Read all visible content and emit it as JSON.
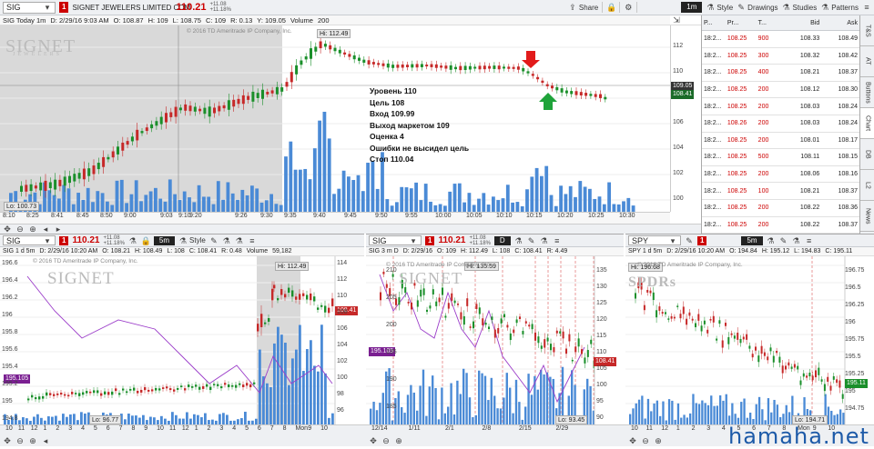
{
  "top": {
    "symbol": "SIG",
    "flag": "1",
    "company": "SIGNET JEWELERS LIMITED COM",
    "price": "110.21",
    "chg1": "+11.08",
    "chg2": "+11.18%",
    "share": "Share",
    "lock": "",
    "gear": ""
  },
  "main_toolbar": {
    "time": "1m",
    "style": "Style",
    "drawings": "Drawings",
    "studies": "Studies",
    "patterns": "Patterns"
  },
  "main_info": {
    "title": "SIG Today 1m",
    "date": "D: 2/29/16 9:03 AM",
    "o": "O: 108.87",
    "h": "H: 109",
    "l": "L: 108.75",
    "c": "C: 109",
    "r": "R: 0.13",
    "y": "Y: 109.05",
    "vol": "Volume",
    "volv": "200"
  },
  "badges": [
    {
      "t": "lomonov",
      "c": "#333"
    },
    {
      "t": "ATR 4.19",
      "c": "#333"
    },
    {
      "t": "Vol 2,090,444",
      "c": "#8bd17f"
    },
    {
      "t": "VolPlay 1.5",
      "c": "#8bd17f"
    },
    {
      "t": "3.8%",
      "c": "#f0a0a0"
    },
    {
      "t": "M 59%",
      "c": "#7a1f91"
    },
    {
      "t": "D 25%",
      "c": "#f6a01a"
    }
  ],
  "main": {
    "copyright": "© 2016 TD Ameritrade IP Company, Inc.",
    "hi": "Hi: 112.49",
    "lo": "Lo: 100.73",
    "tag_price": "109.05",
    "tag_price2": "108.41",
    "yticks": [
      "112",
      "110",
      "108",
      "106",
      "104",
      "102",
      "100"
    ],
    "xticks": [
      "8:10",
      "8:25",
      "8:41",
      "8:45",
      "8:50",
      "9:00",
      "9:03",
      "9:10",
      "9:20",
      "9:26",
      "9:30",
      "9:35",
      "9:40",
      "9:45",
      "9:50",
      "9:55",
      "10:00",
      "10:05",
      "10:10",
      "10:15",
      "10:20",
      "10:25",
      "10:30"
    ],
    "note": [
      "Уровень 110",
      "Цель 108",
      "Вход 109.99",
      "Выход маркетом 109",
      "Оценка 4",
      "Ошибки не высидел цель",
      " Стоп 110.04"
    ]
  },
  "ts": {
    "headers": [
      "P...",
      "Pr...",
      "T...",
      "Bid",
      "Ask"
    ],
    "rows": [
      [
        "18:2...",
        "108.25",
        "900",
        "108.33",
        "108.49"
      ],
      [
        "18:2...",
        "108.25",
        "300",
        "108.32",
        "108.42"
      ],
      [
        "18:2...",
        "108.25",
        "400",
        "108.21",
        "108.37"
      ],
      [
        "18:2...",
        "108.25",
        "200",
        "108.12",
        "108.30"
      ],
      [
        "18:2...",
        "108.25",
        "200",
        "108.03",
        "108.24"
      ],
      [
        "18:2...",
        "108.26",
        "200",
        "108.03",
        "108.24"
      ],
      [
        "18:2...",
        "108.25",
        "200",
        "108.01",
        "108.17"
      ],
      [
        "18:2...",
        "108.25",
        "500",
        "108.11",
        "108.15"
      ],
      [
        "18:2...",
        "108.25",
        "200",
        "108.06",
        "108.16"
      ],
      [
        "18:2...",
        "108.25",
        "100",
        "108.21",
        "108.37"
      ],
      [
        "18:2...",
        "108.25",
        "200",
        "108.22",
        "108.36"
      ],
      [
        "18:2...",
        "108.25",
        "200",
        "108.22",
        "108.37"
      ],
      [
        "18:2...",
        "108.25",
        "200",
        "108.22",
        "108.37"
      ],
      [
        "18:2...",
        "108.25",
        "400",
        "108.21",
        "108.37"
      ],
      [
        "18:2...",
        "108.25",
        "200",
        "108.21",
        "108.35"
      ]
    ]
  },
  "side_tabs": [
    "T&S",
    "AT",
    "Buttons",
    "Chart",
    "DB",
    "L2",
    "News"
  ],
  "p1": {
    "symbol": "SIG",
    "flag": "1",
    "price": "110.21",
    "chg1": "+11.08",
    "chg2": "+11.18%",
    "time": "5m",
    "style": "Style",
    "info": "SIG 1 d 5m",
    "date": "D: 2/29/16 10:20 AM",
    "o": "O: 108.21",
    "h": "H: 108.49",
    "l": "L: 108",
    "c": "C: 108.41",
    "r": "R: 0.48",
    "vol": "Volume",
    "volv": "59,182",
    "copyright": "© 2016 TD Ameritrade IP Company, Inc.",
    "hi": "Hi: 112.49",
    "lo": "Lo: 96.77",
    "tagL": "195.105",
    "tagR": "108.41",
    "yl": [
      "196.6",
      "196.4",
      "196.2",
      "196",
      "195.8",
      "195.6",
      "195.4",
      "195.2",
      "195",
      "194.8"
    ],
    "yr": [
      "114",
      "112",
      "110",
      "108",
      "106",
      "104",
      "102",
      "100",
      "98",
      "96"
    ],
    "x": [
      "10",
      "11",
      "12",
      "1",
      "2",
      "3",
      "4",
      "5",
      "6",
      "7",
      "8",
      "9",
      "10",
      "11",
      "12",
      "1",
      "2",
      "3",
      "4",
      "5",
      "6",
      "7",
      "8",
      "Mon",
      "9",
      "10"
    ]
  },
  "p2": {
    "symbol": "SIG",
    "flag": "1",
    "price": "110.21",
    "chg1": "+11.08",
    "chg2": "+11.18%",
    "time": "D",
    "info": "SIG 3 m D",
    "date": "D: 2/29/16",
    "o": "O: 109",
    "h": "H: 112.49",
    "l": "L: 108",
    "c": "C: 108.41",
    "r": "R: 4.49",
    "copyright": "© 2016 TD Ameritrade IP Company, Inc.",
    "hi": "Hi: 135.59",
    "lo": "Lo: 93.45",
    "tagL": "195.105",
    "tagR": "108.41",
    "yl": [
      "210",
      "205",
      "200",
      "195",
      "190",
      "185"
    ],
    "yr": [
      "135",
      "130",
      "125",
      "120",
      "115",
      "110",
      "105",
      "100",
      "95",
      "90"
    ],
    "x": [
      "12/14",
      "1/11",
      "2/1",
      "2/8",
      "2/15",
      "2/29"
    ]
  },
  "p3": {
    "symbol": "SPY",
    "flag": "1",
    "time": "5m",
    "info": "SPY 1 d 5m",
    "date": "D: 2/29/16 10:20 AM",
    "o": "O: 194.84",
    "h": "H: 195.12",
    "l": "L: 194.83",
    "c": "C: 195.11",
    "copyright": "© 2016 TD Ameritrade IP Company, Inc.",
    "hi": "Hi: 196.68",
    "lo": "Lo: 194.71",
    "tagR": "195.11",
    "yr": [
      "196.75",
      "196.5",
      "196.25",
      "196",
      "195.75",
      "195.5",
      "195.25",
      "195",
      "194.75"
    ],
    "x": [
      "10",
      "11",
      "12",
      "1",
      "2",
      "3",
      "4",
      "5",
      "6",
      "7",
      "8",
      "Mon",
      "9",
      "10"
    ]
  },
  "watermark": {
    "text": "hamaha.net"
  },
  "logos": {
    "signet": "SIGNET",
    "signet_sub": "JEWELERS",
    "spdr": "SPDRs"
  }
}
